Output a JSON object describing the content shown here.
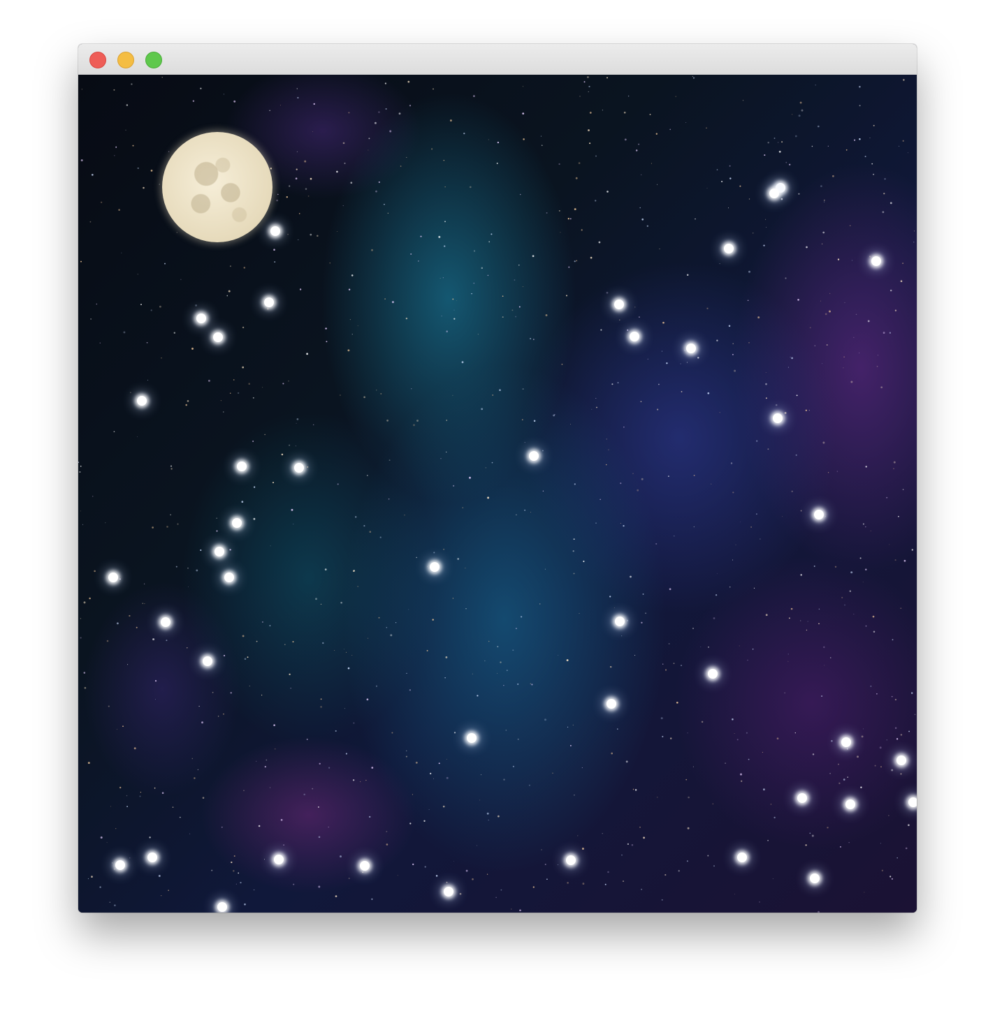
{
  "window": {
    "controls": [
      "close",
      "minimize",
      "zoom"
    ],
    "colors": {
      "close": "#ee5d57",
      "minimize": "#f4bd43",
      "zoom": "#5fc84c"
    }
  },
  "scene": {
    "description_icons": [
      "moon-icon",
      "star-icon"
    ],
    "background_colors": [
      "#070b14",
      "#186e8c",
      "#2d378c",
      "#5f2882"
    ],
    "moon_color": "#efe6cc",
    "star_color": "#ffffff",
    "star_count": 49
  }
}
